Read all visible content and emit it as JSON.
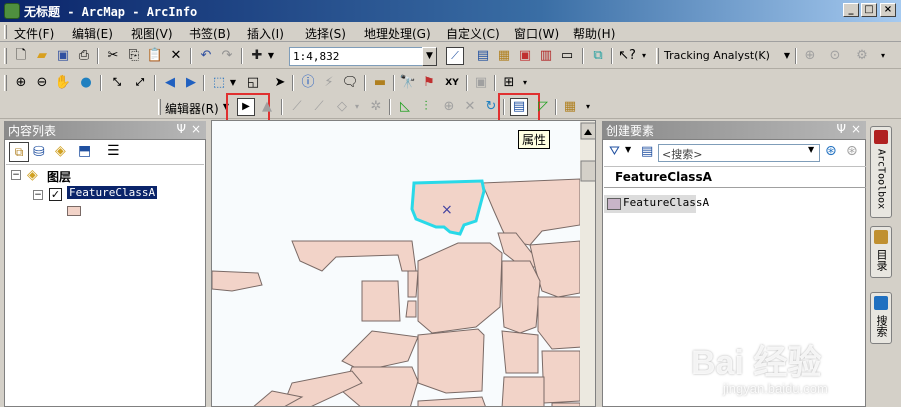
{
  "window": {
    "title": "无标题 - ArcMap - ArcInfo",
    "minimize": "_",
    "maximize": "□",
    "close": "×"
  },
  "menu": [
    {
      "label": "文件(F)"
    },
    {
      "label": "编辑(E)"
    },
    {
      "label": "视图(V)"
    },
    {
      "label": "书签(B)"
    },
    {
      "label": "插入(I)"
    },
    {
      "label": "选择(S)"
    },
    {
      "label": "地理处理(G)"
    },
    {
      "label": "自定义(C)"
    },
    {
      "label": "窗口(W)"
    },
    {
      "label": "帮助(H)"
    }
  ],
  "toolbar": {
    "scale": "1:4,832",
    "tracking_analyst": "Tracking Analyst(K)",
    "editor_label": "编辑器(R)",
    "attributes_tooltip": "属性"
  },
  "toc": {
    "title": "内容列表",
    "layers_group": "图层",
    "layer_name": "FeatureClassA",
    "layer_checked": true,
    "pin": "Ψ",
    "close": "×",
    "symbol_color": "#f2d3c8"
  },
  "features_panel": {
    "title": "创建要素",
    "search_placeholder": "<搜索>",
    "class_header": "FeatureClassA",
    "template_label": "FeatureClassA",
    "template_color": "#c8b4c8",
    "pin": "Ψ",
    "close": "×"
  },
  "dock": {
    "arctoolbox": "ArcToolbox",
    "catalog": "目录",
    "search": "搜索"
  },
  "map": {
    "polygon_fill": "#f2d3c8",
    "polygon_stroke": "#7a6a66",
    "selection_color": "#29d9e8",
    "vertex_mark": "×"
  },
  "watermark": {
    "brand": "Bai 经验",
    "url": "jingyan.baidu.com"
  }
}
